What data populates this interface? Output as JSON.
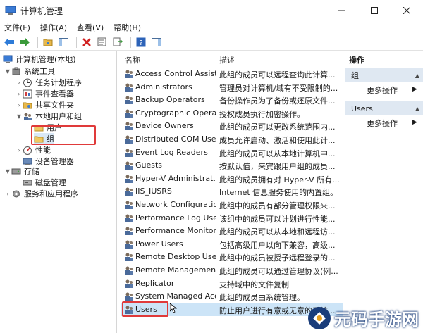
{
  "window": {
    "title": "计算机管理"
  },
  "menu": [
    "文件(F)",
    "操作(A)",
    "查看(V)",
    "帮助(H)"
  ],
  "tree": {
    "root": "计算机管理(本地)",
    "system_tools": "系统工具",
    "task_scheduler": "任务计划程序",
    "event_viewer": "事件查看器",
    "shared_folders": "共享文件夹",
    "local_users_groups": "本地用户和组",
    "users": "用户",
    "groups": "组",
    "performance": "性能",
    "device_manager": "设备管理器",
    "storage": "存储",
    "disk_management": "磁盘管理",
    "services_apps": "服务和应用程序"
  },
  "list": {
    "col_name": "名称",
    "col_desc": "描述",
    "rows": [
      {
        "name": "Access Control Assist...",
        "desc": "此组的成员可以远程查询此计算..."
      },
      {
        "name": "Administrators",
        "desc": "管理员对计算机/域有不受限制的..."
      },
      {
        "name": "Backup Operators",
        "desc": "备份操作员为了备份或还原文件..."
      },
      {
        "name": "Cryptographic Operat...",
        "desc": "授权成员执行加密操作。"
      },
      {
        "name": "Device Owners",
        "desc": "此组的成员可以更改系统范围内..."
      },
      {
        "name": "Distributed COM Users",
        "desc": "成员允许启动、激活和使用此计..."
      },
      {
        "name": "Event Log Readers",
        "desc": "此组的成员可以从本地计算机中..."
      },
      {
        "name": "Guests",
        "desc": "按默认值，来宾跟用户组的成员..."
      },
      {
        "name": "Hyper-V Administrat...",
        "desc": "此组的成员拥有对 Hyper-V 所有..."
      },
      {
        "name": "IIS_IUSRS",
        "desc": "Internet 信息服务使用的内置组。"
      },
      {
        "name": "Network Configuratio...",
        "desc": "此组中的成员有部分管理权限来..."
      },
      {
        "name": "Performance Log Users",
        "desc": "该组中的成员可以计划进行性能..."
      },
      {
        "name": "Performance Monitor...",
        "desc": "此组的成员可以从本地和远程访..."
      },
      {
        "name": "Power Users",
        "desc": "包括高级用户以向下兼容，高级..."
      },
      {
        "name": "Remote Desktop Users",
        "desc": "此组中的成员被授予远程登录的..."
      },
      {
        "name": "Remote Managemen...",
        "desc": "此组的成员可以通过管理协议(例..."
      },
      {
        "name": "Replicator",
        "desc": "支持域中的文件复制"
      },
      {
        "name": "System Managed Acc...",
        "desc": "此组的成员由系统管理。"
      },
      {
        "name": "Users",
        "desc": "防止用户进行有意或无意的系统..."
      }
    ]
  },
  "actions": {
    "title": "操作",
    "section_group": "组",
    "more_1": "更多操作",
    "section_users": "Users",
    "more_2": "更多操作"
  },
  "watermark": {
    "text": "元码手游网"
  }
}
